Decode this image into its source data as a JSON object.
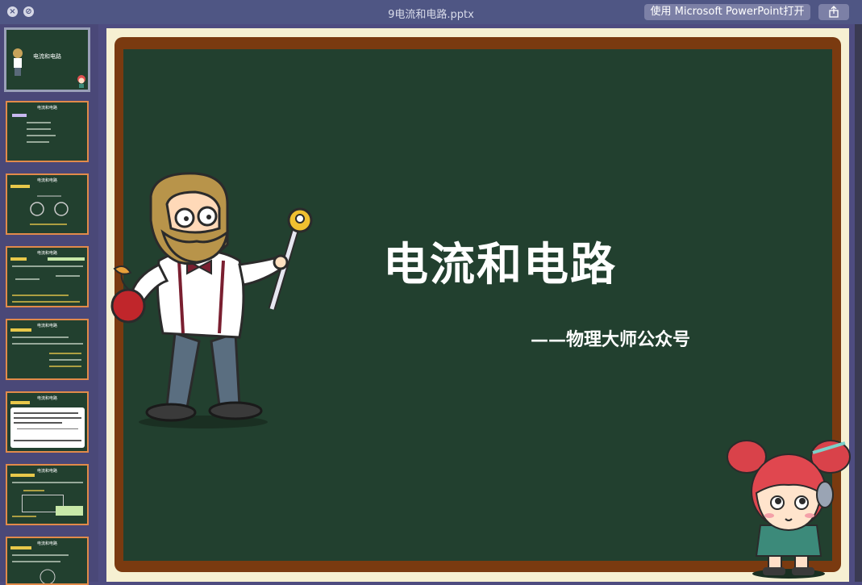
{
  "window": {
    "title": "9电流和电路.pptx",
    "open_button_label": "使用 Microsoft PowerPoint打开",
    "close_icon": "close-icon",
    "minimize_icon": "minimize-icon",
    "share_icon": "share-icon"
  },
  "slide": {
    "title": "电流和电路",
    "subtitle": "——物理大师公众号"
  },
  "thumbnails": [
    {
      "title": "电流和电路"
    },
    {
      "title": "电流和电路"
    },
    {
      "title": "电流和电路"
    },
    {
      "title": "电流和电路"
    },
    {
      "title": "电流和电路"
    },
    {
      "title": "电流和电路"
    },
    {
      "title": "电流和电路"
    },
    {
      "title": "电流和电路"
    }
  ],
  "colors": {
    "board": "#22402f",
    "frame": "#7a3a10",
    "stage": "#f6f0d2",
    "sidebar": "#4a4878"
  }
}
